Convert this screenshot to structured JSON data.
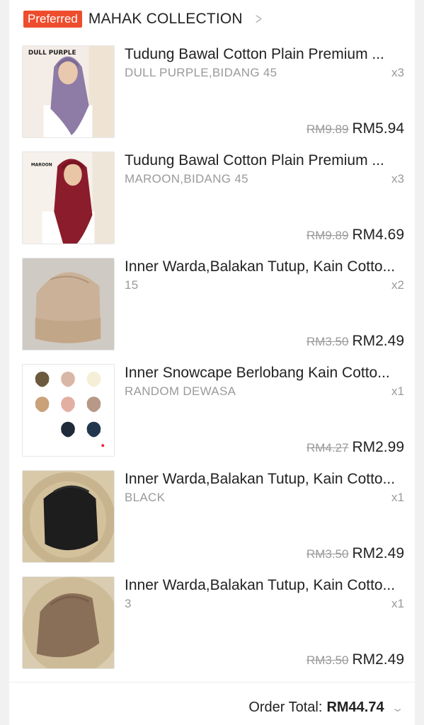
{
  "shop": {
    "badge": "Preferred",
    "name": "MAHAK COLLECTION",
    "chevron_icon": "chevron-right-icon"
  },
  "items": [
    {
      "title": "Tudung Bawal Cotton Plain Premium ...",
      "variant": "DULL PURPLE,BIDANG 45",
      "qty": "x3",
      "old_price": "RM9.89",
      "price": "RM5.94",
      "image_label": "DULL PURPLE"
    },
    {
      "title": "Tudung Bawal Cotton Plain Premium ...",
      "variant": "MAROON,BIDANG 45",
      "qty": "x3",
      "old_price": "RM9.89",
      "price": "RM4.69",
      "image_label": "MAROON"
    },
    {
      "title": "Inner Warda,Balakan Tutup, Kain Cotto...",
      "variant": "15",
      "qty": "x2",
      "old_price": "RM3.50",
      "price": "RM2.49"
    },
    {
      "title": "Inner Snowcape Berlobang Kain Cotto...",
      "variant": "RANDOM DEWASA",
      "qty": "x1",
      "old_price": "RM4.27",
      "price": "RM2.99"
    },
    {
      "title": "Inner Warda,Balakan Tutup, Kain Cotto...",
      "variant": "BLACK",
      "qty": "x1",
      "old_price": "RM3.50",
      "price": "RM2.49"
    },
    {
      "title": "Inner Warda,Balakan Tutup, Kain Cotto...",
      "variant": "3",
      "qty": "x1",
      "old_price": "RM3.50",
      "price": "RM2.49"
    }
  ],
  "order_total": {
    "label": "Order Total:",
    "amount": "RM44.74",
    "icon": "chevron-down-icon"
  },
  "colors": {
    "accent": "#ee4d2d",
    "text": "#222222",
    "muted": "#9a9a9a"
  }
}
